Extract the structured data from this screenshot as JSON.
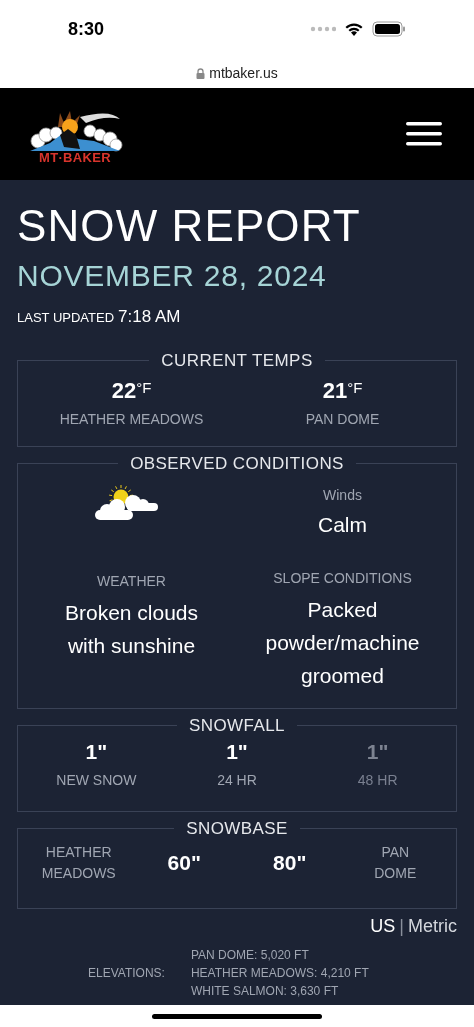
{
  "status_bar": {
    "time": "8:30"
  },
  "browser": {
    "url": "mtbaker.us"
  },
  "header": {
    "logo_text": "MT·BAKER"
  },
  "report": {
    "title": "SNOW REPORT",
    "date": "NOVEMBER 28, 2024",
    "updated_label": "LAST UPDATED",
    "updated_time": "7:18 AM"
  },
  "current_temps": {
    "legend": "CURRENT TEMPS",
    "items": [
      {
        "value": "22",
        "unit": "°F",
        "label": "HEATHER MEADOWS"
      },
      {
        "value": "21",
        "unit": "°F",
        "label": "PAN DOME"
      }
    ]
  },
  "observed": {
    "legend": "OBSERVED CONDITIONS",
    "weather_label": "WEATHER",
    "weather": "Broken clouds with sunshine",
    "winds_label": "Winds",
    "winds": "Calm",
    "slope_label": "SLOPE CONDITIONS",
    "slope": "Packed powder/machine groomed"
  },
  "snowfall": {
    "legend": "SNOWFALL",
    "items": [
      {
        "value": "1\"",
        "label": "NEW SNOW",
        "dimmed": false
      },
      {
        "value": "1\"",
        "label": "24 HR",
        "dimmed": false
      },
      {
        "value": "1\"",
        "label": "48 HR",
        "dimmed": true
      }
    ]
  },
  "snowbase": {
    "legend": "SNOWBASE",
    "left_label": "HEATHER MEADOWS",
    "left_value": "60\"",
    "right_value": "80\"",
    "right_label": "PAN DOME"
  },
  "units": [
    {
      "label": "US",
      "selected": true
    },
    {
      "label": "Metric",
      "selected": false
    }
  ],
  "units_separator": "|",
  "elevations": {
    "label": "ELEVATIONS:",
    "lines": [
      "PAN DOME: 5,020 FT",
      "HEATHER MEADOWS: 4,210 FT",
      "WHITE SALMON: 3,630 FT"
    ]
  }
}
